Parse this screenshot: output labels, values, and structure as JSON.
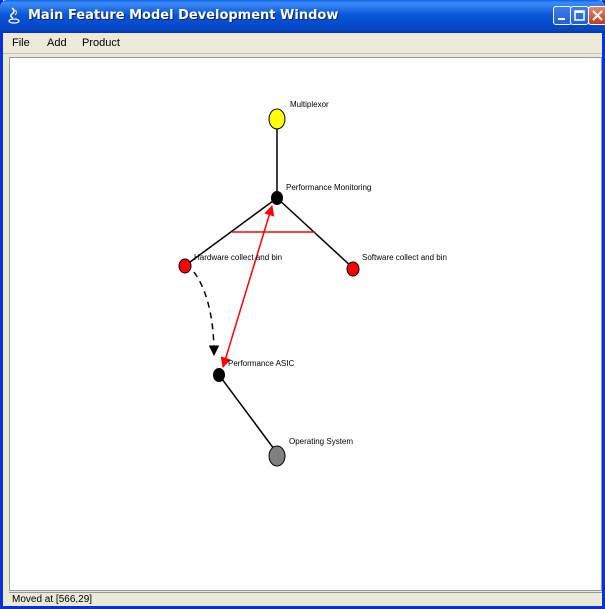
{
  "window": {
    "title": "Main Feature Model Development Window"
  },
  "menu": {
    "items": [
      "File",
      "Add",
      "Product"
    ]
  },
  "nodes": {
    "multiplexor": {
      "label": "Multiplexor",
      "color": "#ffff00"
    },
    "performance_monitoring": {
      "label": "Performance Monitoring",
      "color": "#000000"
    },
    "hardware_collect": {
      "label": "Hardware collect and bin",
      "color": "#ff0000"
    },
    "software_collect": {
      "label": "Software collect and bin",
      "color": "#ff0000"
    },
    "performance_asic": {
      "label": "Performance ASIC",
      "color": "#000000"
    },
    "operating_system": {
      "label": "Operating System",
      "color": "#808080"
    }
  },
  "colors": {
    "titlebar": "#0a57d9",
    "constraint": "#ff0000",
    "edge": "#000000"
  },
  "statusbar": {
    "text": "Moved at [566,29]"
  }
}
